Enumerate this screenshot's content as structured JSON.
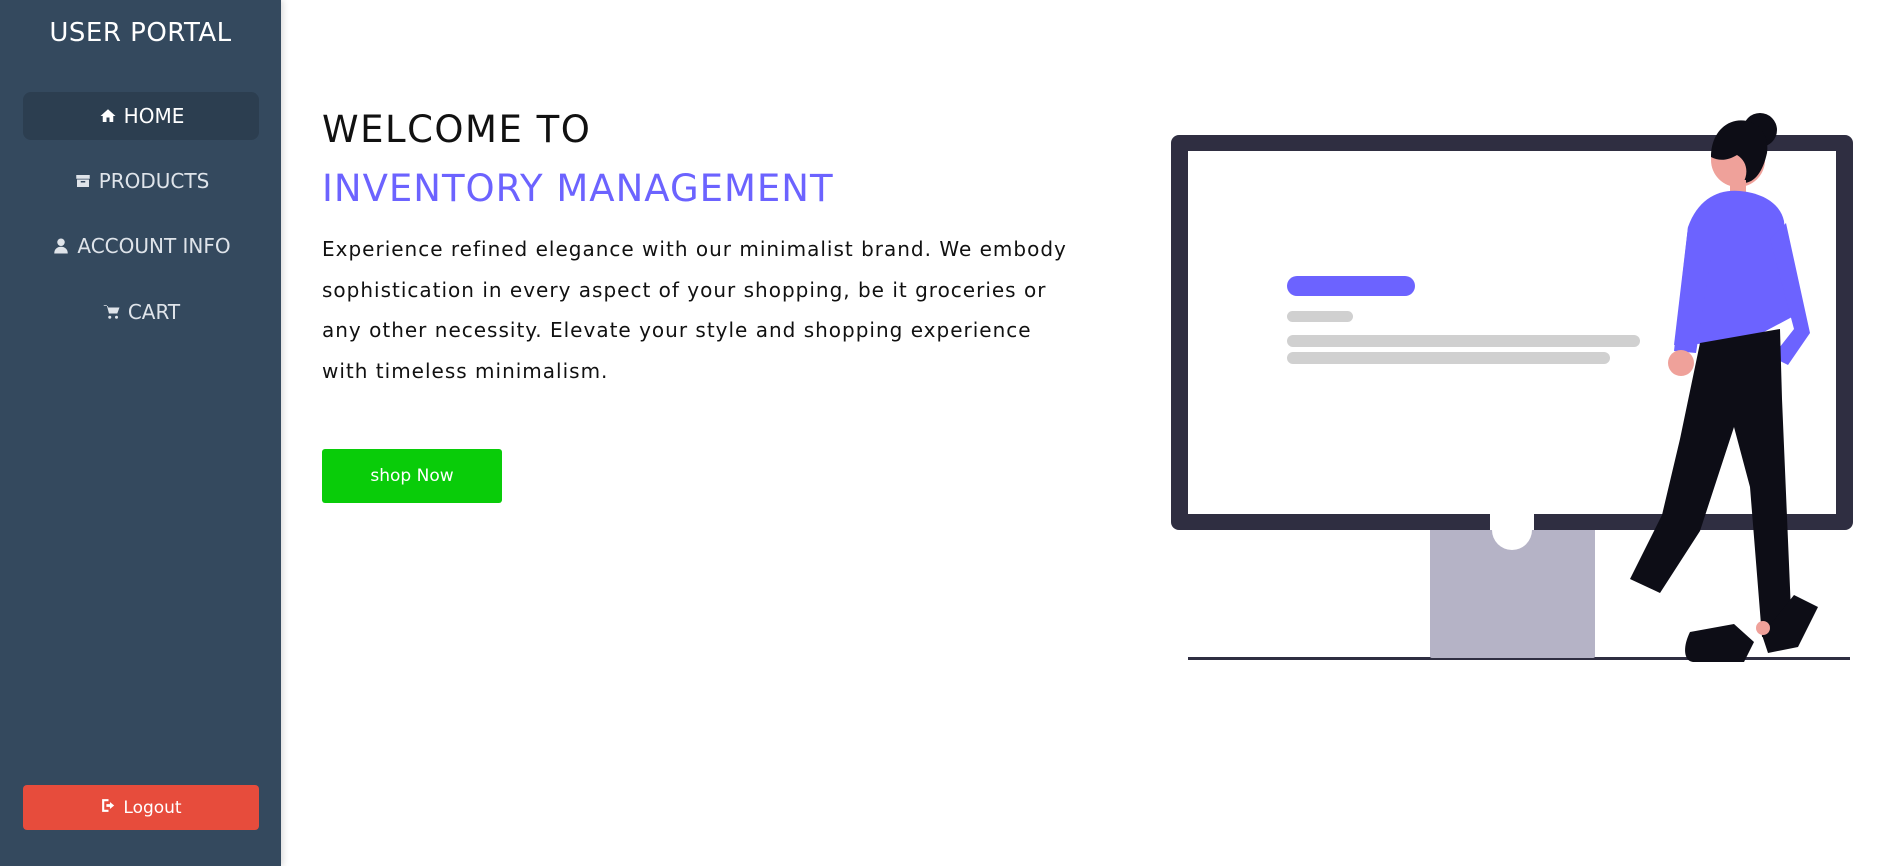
{
  "sidebar": {
    "brand": "USER PORTAL",
    "items": [
      {
        "label": "HOME",
        "icon": "home-icon",
        "active": true
      },
      {
        "label": "PRODUCTS",
        "icon": "box-icon",
        "active": false
      },
      {
        "label": "ACCOUNT INFO",
        "icon": "user-icon",
        "active": false
      },
      {
        "label": "CART",
        "icon": "cart-icon",
        "active": false
      }
    ],
    "logout_label": "Logout"
  },
  "hero": {
    "welcome": "WELCOME TO",
    "title": "INVENTORY MANAGEMENT",
    "description": "Experience refined elegance with our minimalist brand. We embody sophistication in every aspect of your shopping, be it groceries or any other necessity. Elevate your style and shopping experience with timeless minimalism.",
    "cta_label": "shop Now"
  },
  "colors": {
    "sidebar_bg": "#34495e",
    "sidebar_active": "#2c3e50",
    "accent": "#6c63ff",
    "cta": "#09cc09",
    "logout": "#e74c3c"
  }
}
